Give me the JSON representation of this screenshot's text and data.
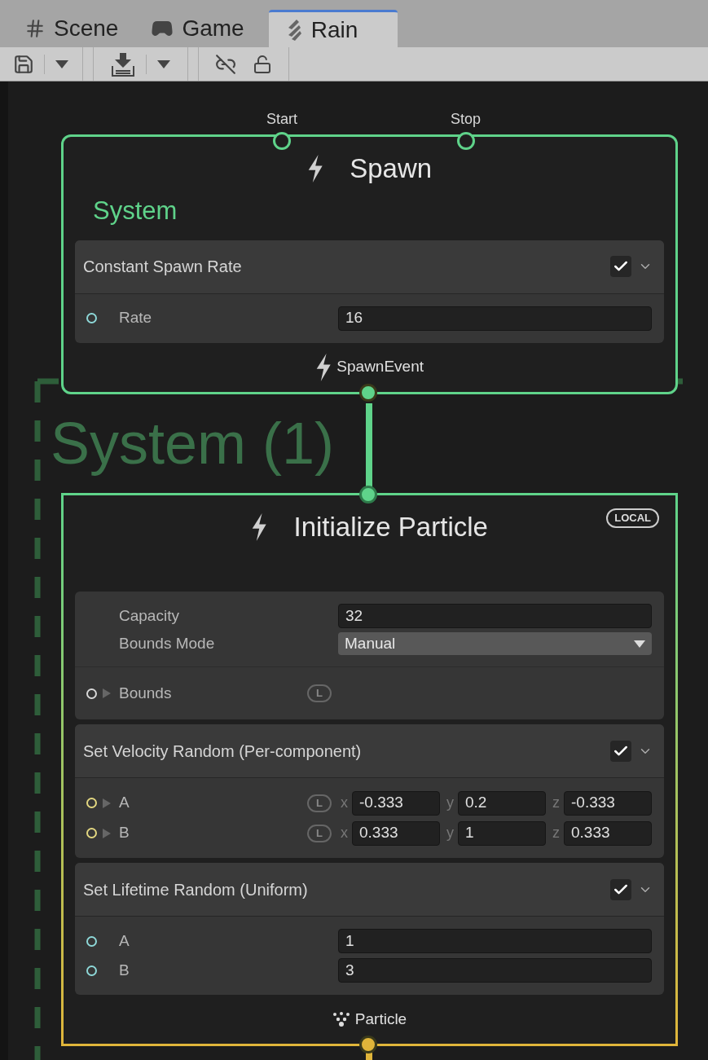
{
  "tabs": [
    {
      "kind": "grid",
      "label": "Scene",
      "selected": false
    },
    {
      "kind": "gamepad",
      "label": "Game",
      "selected": false
    },
    {
      "kind": "rain",
      "label": "Rain",
      "selected": true
    }
  ],
  "graph": {
    "group_title": "System (1)",
    "nodes": [
      {
        "kind": "spawn",
        "title": "Spawn",
        "inputs": [
          "Start",
          "Stop"
        ],
        "system_label": "System",
        "color": "#5fd38a",
        "blocks": [
          {
            "title": "Constant Spawn Rate",
            "enabled": true,
            "sections": [
              [
                {
                  "kind": "scalar",
                  "label": "Rate",
                  "color": "#8ed8d8",
                  "value": "16"
                }
              ]
            ]
          }
        ],
        "output": {
          "kind": "event",
          "label": "SpawnEvent"
        }
      },
      {
        "kind": "initialize",
        "title": "Initialize Particle",
        "badge": "LOCAL",
        "color": "#e0b53a",
        "blocks": [
          {
            "sections": [
              [
                {
                  "kind": "setting",
                  "label": "Capacity",
                  "value": "32"
                },
                {
                  "kind": "dropdown",
                  "label": "Bounds Mode",
                  "value": "Manual"
                }
              ],
              [
                {
                  "kind": "expandable",
                  "label": "Bounds",
                  "color": "#d8d8d8",
                  "space": "L"
                }
              ]
            ]
          },
          {
            "title": "Set Velocity Random (Per-component)",
            "enabled": true,
            "sections": [
              [
                {
                  "kind": "vector",
                  "label": "A",
                  "color": "#e2d680",
                  "space": "L",
                  "components": [
                    {
                      "axis": "x",
                      "value": "-0.333"
                    },
                    {
                      "axis": "y",
                      "value": "0.2"
                    },
                    {
                      "axis": "z",
                      "value": "-0.333"
                    }
                  ]
                },
                {
                  "kind": "vector",
                  "label": "B",
                  "color": "#e2d680",
                  "space": "L",
                  "components": [
                    {
                      "axis": "x",
                      "value": "0.333"
                    },
                    {
                      "axis": "y",
                      "value": "1"
                    },
                    {
                      "axis": "z",
                      "value": "0.333"
                    }
                  ]
                }
              ]
            ]
          },
          {
            "title": "Set Lifetime Random (Uniform)",
            "enabled": true,
            "sections": [
              [
                {
                  "kind": "scalar",
                  "label": "A",
                  "color": "#8ed8d8",
                  "value": "1"
                },
                {
                  "kind": "scalar",
                  "label": "B",
                  "color": "#8ed8d8",
                  "value": "3"
                }
              ]
            ]
          }
        ],
        "output": {
          "kind": "particle",
          "label": "Particle"
        }
      }
    ]
  }
}
